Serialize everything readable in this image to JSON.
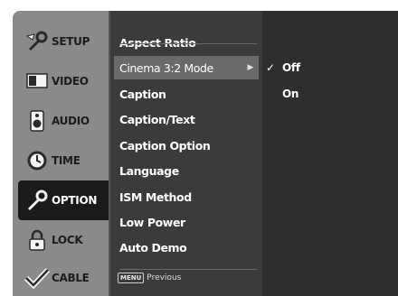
{
  "sidebar": {
    "items": [
      {
        "label": "SETUP",
        "icon": "setup-wrench-icon"
      },
      {
        "label": "VIDEO",
        "icon": "video-tv-icon"
      },
      {
        "label": "AUDIO",
        "icon": "audio-speaker-icon"
      },
      {
        "label": "TIME",
        "icon": "time-clock-icon"
      },
      {
        "label": "OPTION",
        "icon": "option-wrench-icon",
        "active": true
      },
      {
        "label": "LOCK",
        "icon": "lock-icon"
      },
      {
        "label": "CABLE",
        "icon": "cable-check-icon"
      }
    ]
  },
  "menu": {
    "items": [
      {
        "label": "Aspect Ratio"
      },
      {
        "label": "Cinema 3:2 Mode",
        "selected": true,
        "arrow": "▶"
      },
      {
        "label": "Caption"
      },
      {
        "label": "Caption/Text"
      },
      {
        "label": "Caption Option"
      },
      {
        "label": "Language"
      },
      {
        "label": "ISM Method"
      },
      {
        "label": "Low Power"
      },
      {
        "label": "Auto Demo"
      }
    ],
    "footer": {
      "key": "MENU",
      "text": "Previous"
    }
  },
  "submenu": {
    "options": [
      {
        "label": "Off",
        "check": "✓"
      },
      {
        "label": "On",
        "check": ""
      }
    ]
  },
  "colors": {
    "frame": "#8a8a8a",
    "menu_bg": "#3b3b3b",
    "submenu_bg": "#2e2e2e",
    "active_tab": "#1a1a1a",
    "selected_item": "#6a6a6a"
  }
}
